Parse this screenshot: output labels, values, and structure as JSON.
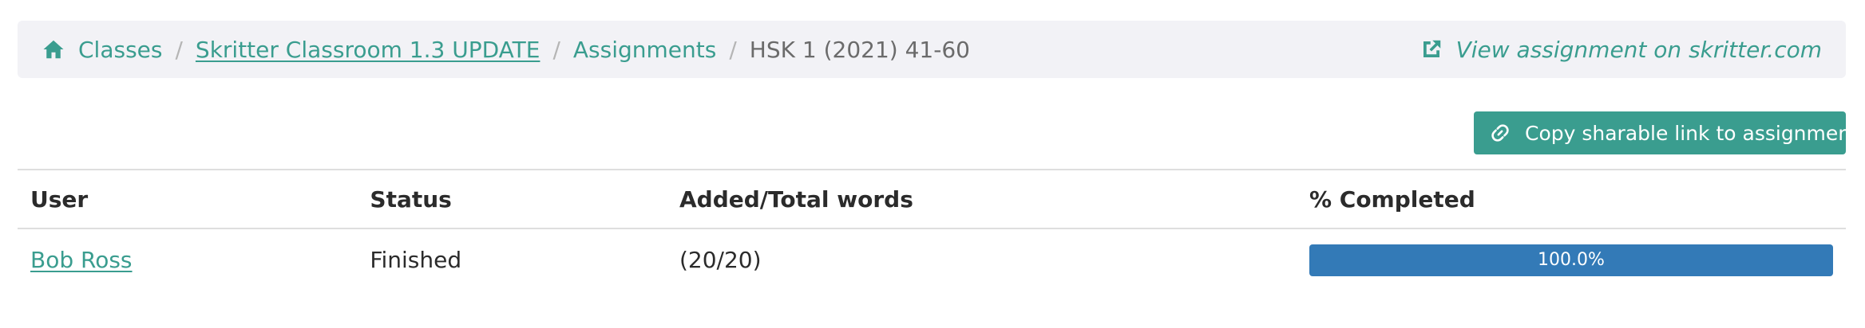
{
  "breadcrumb": {
    "home_icon": "home-icon",
    "items": [
      {
        "label": "Classes"
      },
      {
        "label": "Skritter Classroom 1.3 UPDATE"
      },
      {
        "label": "Assignments"
      },
      {
        "label": "HSK 1 (2021) 41-60"
      }
    ],
    "separator": "/",
    "external_link": {
      "icon": "external-link-icon",
      "label": "View assignment on skritter.com"
    }
  },
  "toolbar": {
    "copy_button": {
      "icon": "link-icon",
      "label": "Copy sharable link to assignment"
    }
  },
  "table": {
    "columns": [
      "User",
      "Status",
      "Added/Total words",
      "% Completed"
    ],
    "rows": [
      {
        "user": "Bob Ross",
        "status": "Finished",
        "words": "(20/20)",
        "percent": 100.0,
        "percent_label": "100.0%"
      }
    ]
  },
  "colors": {
    "accent": "#3a9d8f",
    "progress": "#337ab7",
    "breadcrumb_bg": "#f2f2f6"
  }
}
